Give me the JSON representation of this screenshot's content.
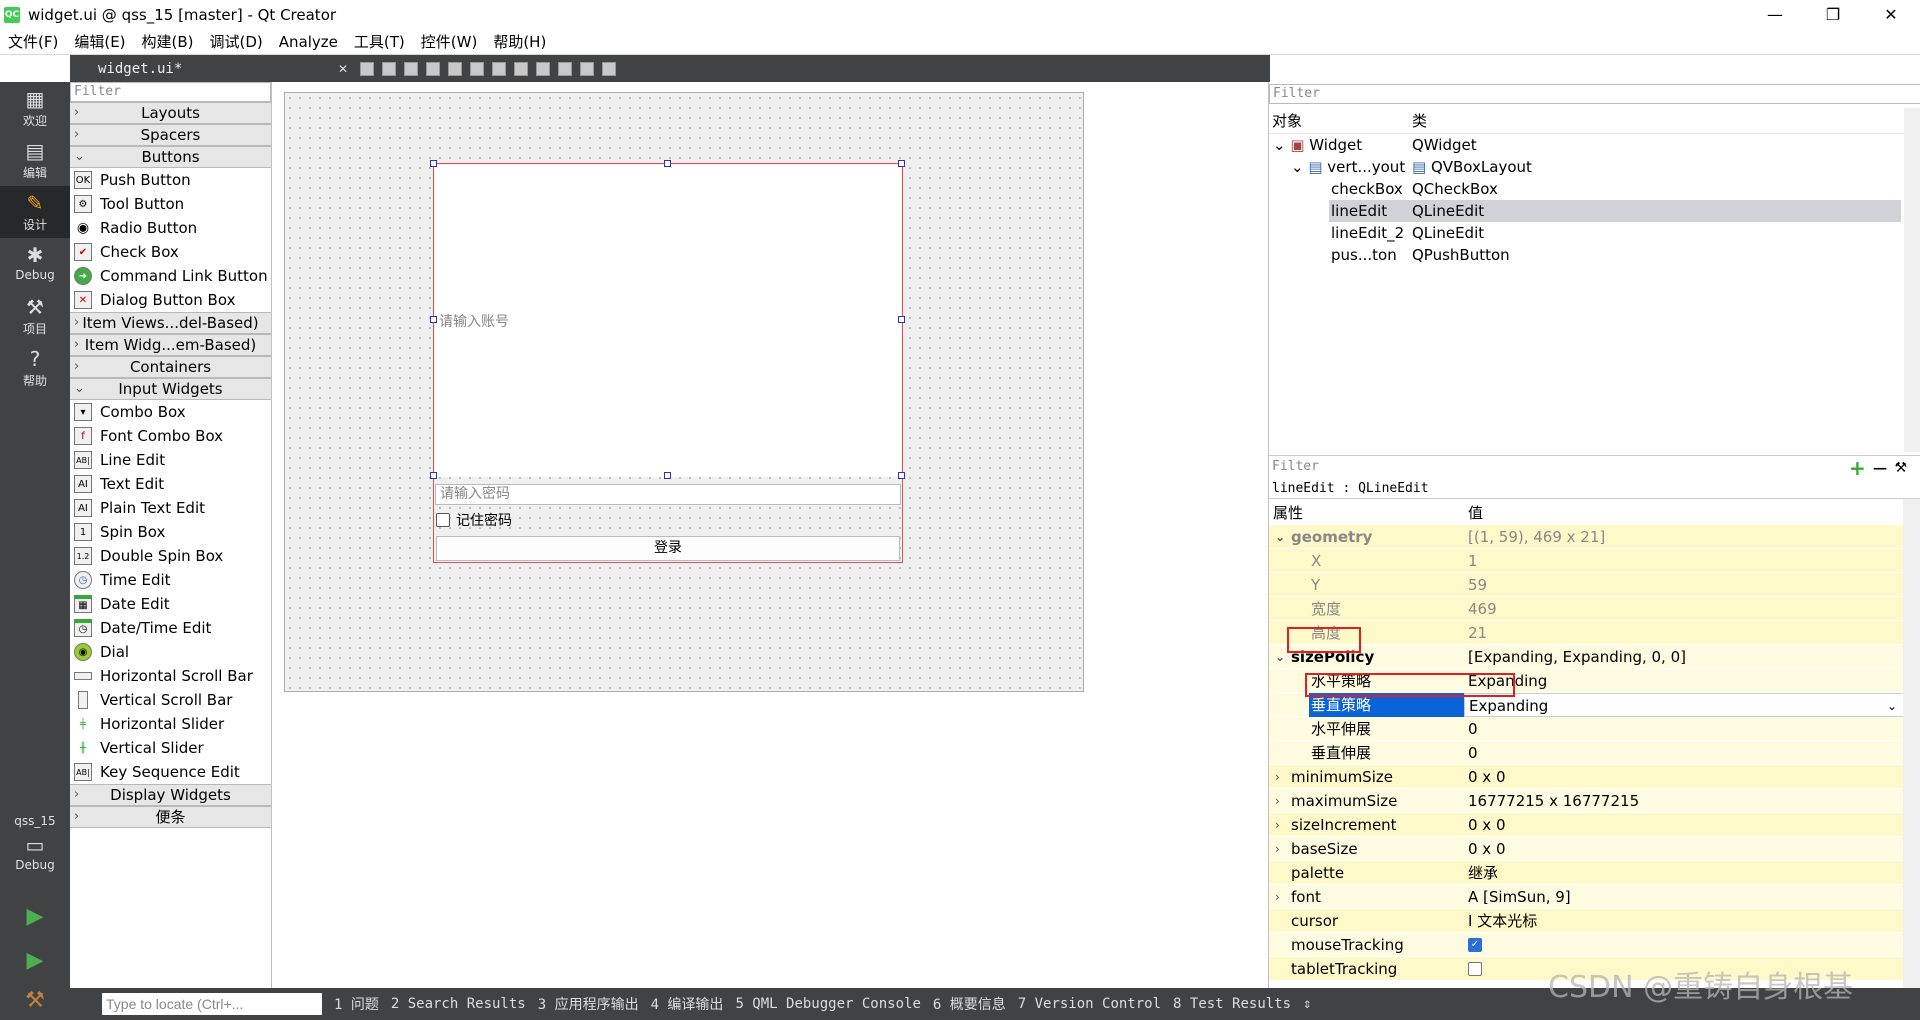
{
  "window": {
    "title": "widget.ui @ qss_15 [master] - Qt Creator",
    "logo": "QC",
    "controls": [
      "—",
      "❐",
      "✕"
    ]
  },
  "menu": [
    "文件(F)",
    "编辑(E)",
    "构建(B)",
    "调试(D)",
    "Analyze",
    "工具(T)",
    "控件(W)",
    "帮助(H)"
  ],
  "modes": [
    {
      "label": "欢迎",
      "icon": "grid-icon"
    },
    {
      "label": "编辑",
      "icon": "edit-icon"
    },
    {
      "label": "设计",
      "icon": "pencil-icon"
    },
    {
      "label": "Debug",
      "icon": "bug-icon"
    },
    {
      "label": "项目",
      "icon": "wrench-icon"
    },
    {
      "label": "帮助",
      "icon": "help-icon"
    }
  ],
  "kit": {
    "project": "qss_15",
    "config": "Debug"
  },
  "editor_tab": "widget.ui*",
  "widgetbox": {
    "filter_placeholder": "Filter",
    "categories_top": [
      "Layouts",
      "Spacers"
    ],
    "buttons_cat": "Buttons",
    "buttons": [
      "Push Button",
      "Tool Button",
      "Radio Button",
      "Check Box",
      "Command Link Button",
      "Dialog Button Box"
    ],
    "mid_cats": [
      "Item Views...del-Based)",
      "Item Widg...em-Based)",
      "Containers"
    ],
    "input_cat": "Input Widgets",
    "inputs": [
      "Combo Box",
      "Font Combo Box",
      "Line Edit",
      "Text Edit",
      "Plain Text Edit",
      "Spin Box",
      "Double Spin Box",
      "Time Edit",
      "Date Edit",
      "Date/Time Edit",
      "Dial",
      "Horizontal Scroll Bar",
      "Vertical Scroll Bar",
      "Horizontal Slider",
      "Vertical Slider",
      "Key Sequence Edit"
    ],
    "bottom_cats": [
      "Display Widgets",
      "便条"
    ]
  },
  "form": {
    "account_placeholder": "请输入账号",
    "password_placeholder": "请输入密码",
    "remember_label": "记住密码",
    "login_label": "登录"
  },
  "objects": {
    "filter_placeholder": "Filter",
    "col_object": "对象",
    "col_class": "类",
    "rows": [
      {
        "name": "Widget",
        "cls": "QWidget"
      },
      {
        "name": "vert...yout",
        "cls": "QVBoxLayout"
      },
      {
        "name": "checkBox",
        "cls": "QCheckBox"
      },
      {
        "name": "lineEdit",
        "cls": "QLineEdit"
      },
      {
        "name": "lineEdit_2",
        "cls": "QLineEdit"
      },
      {
        "name": "pus...ton",
        "cls": "QPushButton"
      }
    ]
  },
  "props": {
    "filter_placeholder": "Filter",
    "object_label": "lineEdit : QLineEdit",
    "col_prop": "属性",
    "col_value": "值",
    "rows": [
      {
        "name": "geometry",
        "value": "[(1, 59), 469 x 21]"
      },
      {
        "name": "X",
        "value": "1"
      },
      {
        "name": "Y",
        "value": "59"
      },
      {
        "name": "宽度",
        "value": "469"
      },
      {
        "name": "高度",
        "value": "21"
      },
      {
        "name": "sizePolicy",
        "value": "[Expanding, Expanding, 0, 0]"
      },
      {
        "name": "水平策略",
        "value": "Expanding"
      },
      {
        "name": "垂直策略",
        "value": "Expanding"
      },
      {
        "name": "水平伸展",
        "value": "0"
      },
      {
        "name": "垂直伸展",
        "value": "0"
      },
      {
        "name": "minimumSize",
        "value": "0 x 0"
      },
      {
        "name": "maximumSize",
        "value": "16777215 x 16777215"
      },
      {
        "name": "sizeIncrement",
        "value": "0 x 0"
      },
      {
        "name": "baseSize",
        "value": "0 x 0"
      },
      {
        "name": "palette",
        "value": "继承"
      },
      {
        "name": "font",
        "value": "[SimSun, 9]"
      },
      {
        "name": "cursor",
        "value": "文本光标"
      },
      {
        "name": "mouseTracking",
        "value": ""
      },
      {
        "name": "tabletTracking",
        "value": ""
      }
    ]
  },
  "statusbar": {
    "locate_placeholder": "Type to locate (Ctrl+...",
    "tabs": [
      "1 问题",
      "2 Search Results",
      "3 应用程序输出",
      "4 编译输出",
      "5 QML Debugger Console",
      "6 概要信息",
      "7 Version Control",
      "8 Test Results"
    ]
  },
  "watermark": "CSDN @重铸自身根基"
}
